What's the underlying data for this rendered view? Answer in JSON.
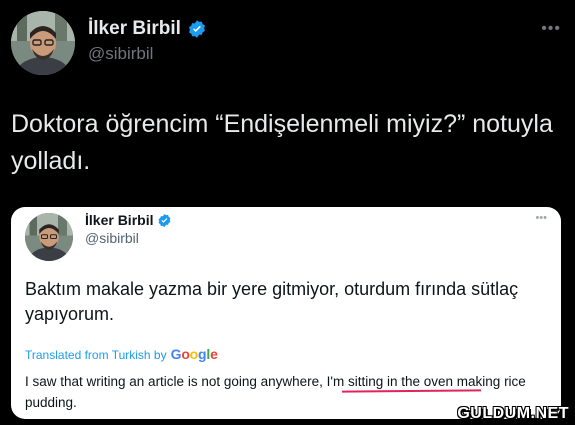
{
  "author": {
    "name": "İlker Birbil",
    "handle": "@sibirbil"
  },
  "tweet_text": "Doktora öğrencim “Endişelenmeli miyiz?” notuyla yolladı.",
  "more_label": "•••",
  "embedded": {
    "author_name": "İlker Birbil",
    "author_handle": "@sibirbil",
    "more_label": "•••",
    "text": "Baktım makale yazma bir yere gitmiyor, oturdum fırında sütlaç yapıyorum.",
    "translated_label": "Translated from Turkish by",
    "translator": "Google",
    "translation": "I saw that writing an article is not going anywhere, I'm sitting in the oven making rice pudding."
  },
  "watermark": "GULDUM.NET",
  "colors": {
    "background": "#000000",
    "verified": "#1d9bf0",
    "underline": "#e0245e",
    "link": "#1d9bf0"
  },
  "icons": {
    "verified": "verified-badge-icon",
    "more": "more-options-icon"
  }
}
